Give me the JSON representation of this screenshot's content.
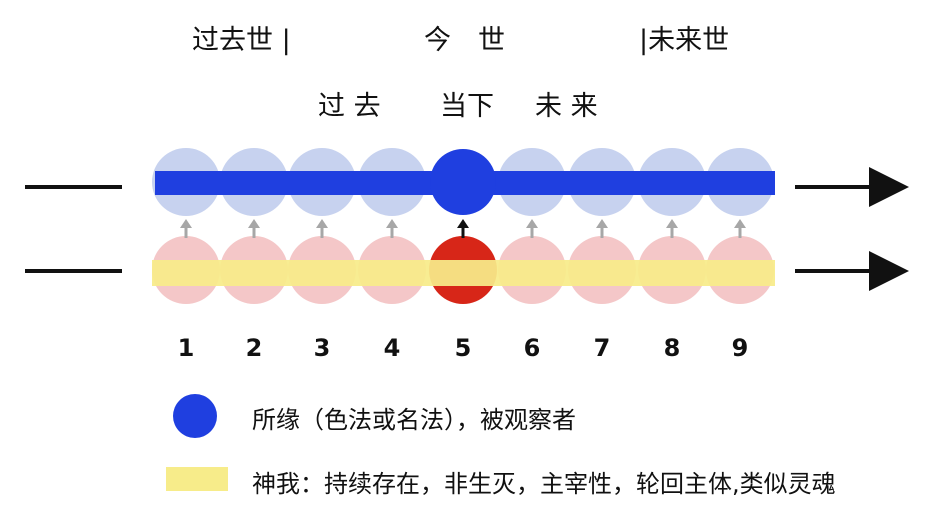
{
  "header": {
    "past_life": "过去世 |",
    "present_life": "今　世",
    "future_life": "|未来世"
  },
  "subheader": {
    "past": "过 去",
    "present": "当下",
    "future": "未 来"
  },
  "numbers": [
    "1",
    "2",
    "3",
    "4",
    "5",
    "6",
    "7",
    "8",
    "9"
  ],
  "legend": {
    "blue_label": "所缘（色法或名法），被观察者",
    "yellow_label": "神我：持续存在，非生灭，主宰性，轮回主体,类似灵魂"
  },
  "colors": {
    "blue_bar": "#1f3fe0",
    "blue_circle_faded": "#c7d2ef",
    "blue_circle_active": "#1f3fe0",
    "pink_circle_faded": "#f4c7c8",
    "red_circle_active": "#d72618",
    "yellow_bar": "#f7ec8a",
    "arrow_gray": "#a7a7a7",
    "arrow_black": "#111111"
  }
}
